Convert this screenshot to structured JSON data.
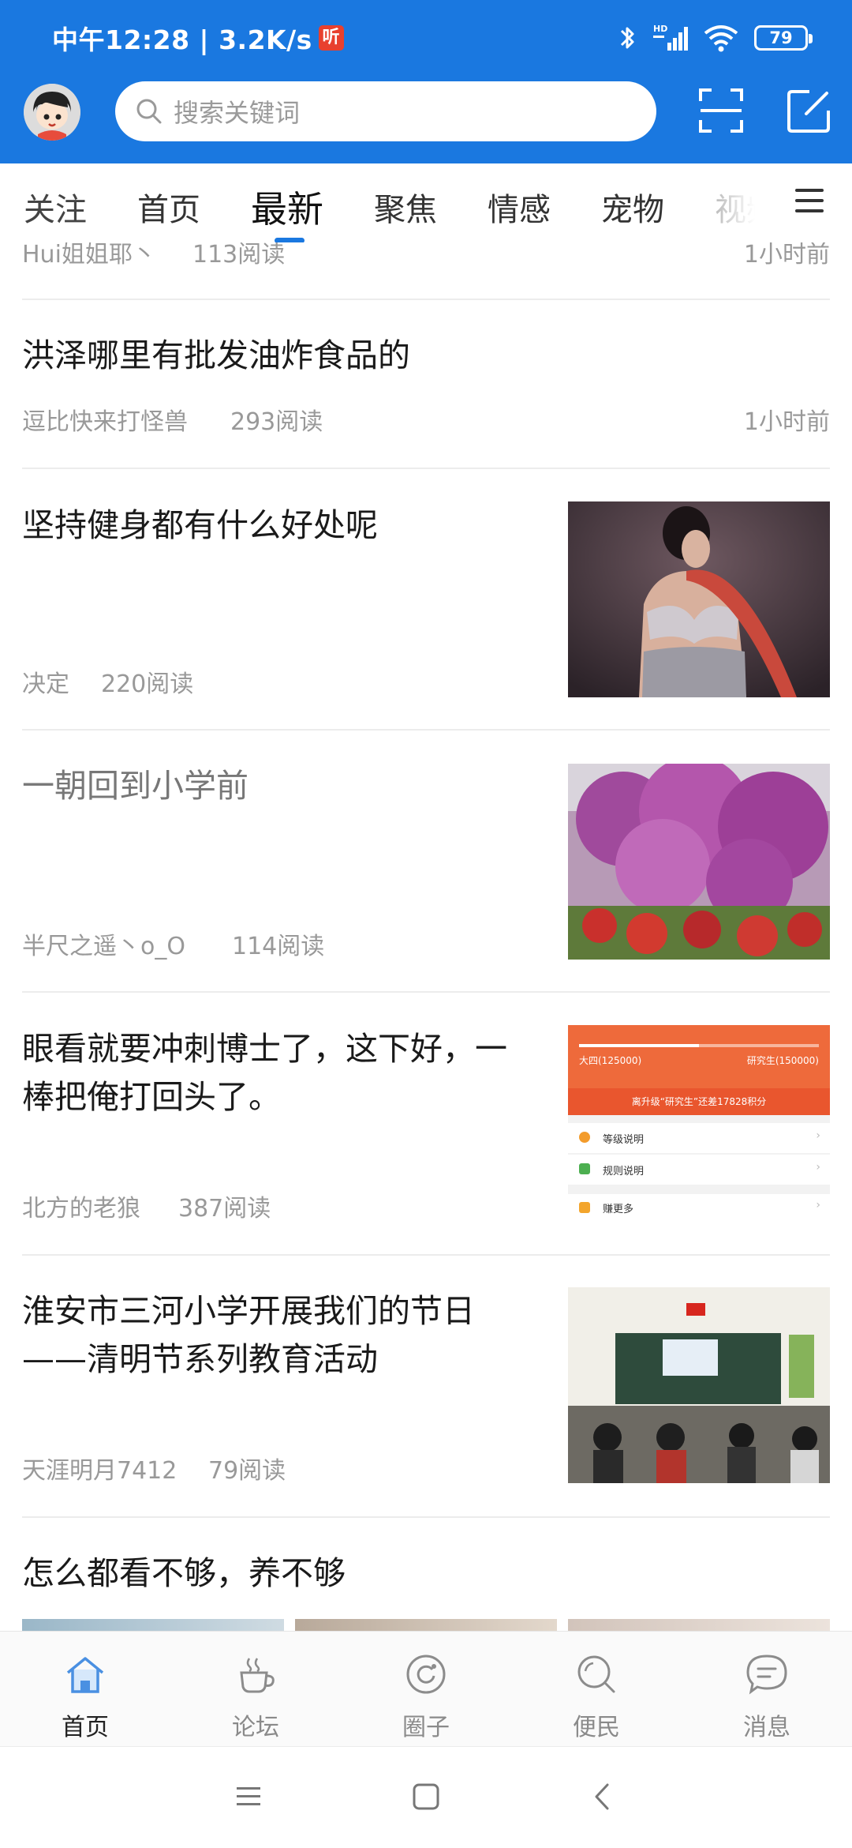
{
  "status_bar": {
    "time_speed": "中午12:28 | 3.2K/s",
    "listen_badge": "听",
    "signal_label": "HD",
    "battery": "79"
  },
  "header": {
    "search_placeholder": "搜索关键词"
  },
  "tabs": [
    {
      "label": "关注"
    },
    {
      "label": "首页"
    },
    {
      "label": "最新",
      "active": true
    },
    {
      "label": "聚焦"
    },
    {
      "label": "情感"
    },
    {
      "label": "宠物"
    },
    {
      "label": "视频"
    }
  ],
  "feed": {
    "partial_row": {
      "author": "Hui姐姐耶丶",
      "reads": "113阅读",
      "time": "1小时前"
    },
    "rows": [
      {
        "title": "洪泽哪里有批发油炸食品的",
        "author": "逗比快来打怪兽",
        "reads": "293阅读",
        "time": "1小时前"
      },
      {
        "title": "坚持健身都有什么好处呢",
        "author": "决定",
        "reads": "220阅读"
      },
      {
        "title": "一朝回到小学前",
        "author": "半尺之遥丶o_O",
        "reads": "114阅读"
      },
      {
        "title_line1": "眼看就要冲刺博士了，这下好，一",
        "title_line2": "棒把俺打回头了。",
        "author": "北方的老狼",
        "reads": "387阅读",
        "thumb": {
          "left_value": "大四(125000)",
          "right_value": "研究生(150000)",
          "banner": "离升级“研究生”还差17828积分",
          "items": [
            "等级说明",
            "规则说明",
            "赚更多"
          ],
          "progress": 0.5
        }
      },
      {
        "title_line1": "淮安市三河小学开展我们的节日",
        "title_line2": "——清明节系列教育活动",
        "author": "天涯明月7412",
        "reads": "79阅读"
      },
      {
        "title": "怎么都看不够，养不够"
      }
    ]
  },
  "bottom_nav": [
    {
      "label": "首页",
      "icon": "home-icon",
      "active": true
    },
    {
      "label": "论坛",
      "icon": "cup-icon"
    },
    {
      "label": "圈子",
      "icon": "circle-icon"
    },
    {
      "label": "便民",
      "icon": "search-icon"
    },
    {
      "label": "消息",
      "icon": "message-icon"
    }
  ],
  "colors": {
    "brand": "#1a78e0",
    "text": "#1a1a1a",
    "meta": "#999999"
  }
}
